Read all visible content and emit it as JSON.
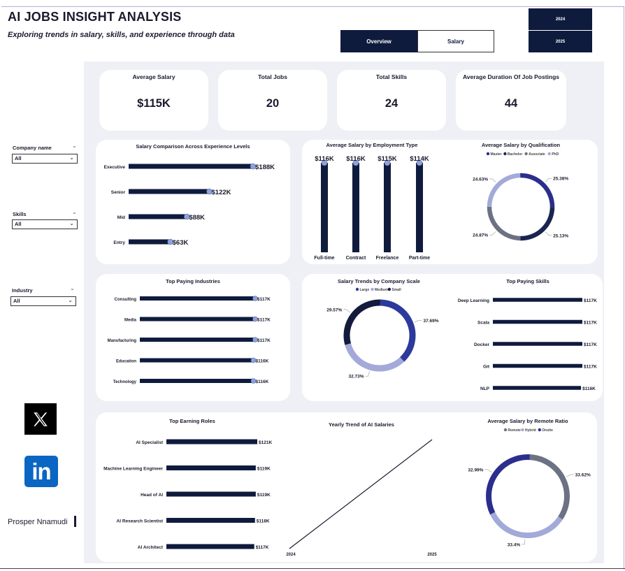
{
  "header": {
    "title": "AI JOBS INSIGHT ANALYSIS",
    "subtitle": "Exploring trends in salary, skills, and experience through data"
  },
  "tabs": {
    "overview": "Overview",
    "salary": "Salary"
  },
  "years": [
    "2024",
    "2025"
  ],
  "kpis": [
    {
      "label": "Average Salary",
      "value": "$115K"
    },
    {
      "label": "Total Jobs",
      "value": "20"
    },
    {
      "label": "Total Skills",
      "value": "24"
    },
    {
      "label": "Average Duration Of Job Postings",
      "value": "44"
    }
  ],
  "slicers": [
    {
      "label": "Company name",
      "value": "All"
    },
    {
      "label": "Skills",
      "value": "All"
    },
    {
      "label": "Industry",
      "value": "All"
    }
  ],
  "author": "Prosper Nnamudi",
  "colors": {
    "navy": "#0f1b3d",
    "dot": "#8ea2dc",
    "donut_dark_blue": "#2b2e8c",
    "donut_navy": "#1a2550",
    "donut_gray": "#6c7283",
    "donut_light": "#a3aad9",
    "background": "#eef0f5"
  },
  "icons": {
    "x_logo": "x-logo-icon",
    "linkedin": "linkedin-logo-icon"
  },
  "chart_data": [
    {
      "id": "experience",
      "type": "bar",
      "title": "Salary Comparison Across Experience Levels",
      "categories": [
        "Executive",
        "Senior",
        "Mid",
        "Entry"
      ],
      "values": [
        188,
        122,
        88,
        63
      ],
      "labels": [
        "$188K",
        "$122K",
        "$88K",
        "$63K"
      ],
      "max": 188
    },
    {
      "id": "employment",
      "type": "bar",
      "title": "Average Salary by Employment Type",
      "categories": [
        "Full-time",
        "Contract",
        "Freelance",
        "Part-time"
      ],
      "values": [
        116,
        116,
        115,
        114
      ],
      "labels": [
        "$116K",
        "$116K",
        "$115K",
        "$114K"
      ]
    },
    {
      "id": "qualification",
      "type": "pie",
      "title": "Average Salary by Qualification",
      "legend": [
        "Master",
        "Bachelor",
        "Associate",
        "PhD"
      ],
      "slices": [
        {
          "name": "Master",
          "value": 25.38,
          "label": "25.38%",
          "color": "#2b2e8c"
        },
        {
          "name": "Bachelor",
          "value": 25.13,
          "label": "25.13%",
          "color": "#1a2550"
        },
        {
          "name": "Associate",
          "value": 24.87,
          "label": "24.87%",
          "color": "#6c7283"
        },
        {
          "name": "PhD",
          "value": 24.63,
          "label": "24.63%",
          "color": "#a3aad9"
        }
      ]
    },
    {
      "id": "industries",
      "type": "bar",
      "title": "Top Paying Industries",
      "categories": [
        "Consulting",
        "Media",
        "Manufacturing",
        "Education",
        "Technology"
      ],
      "values": [
        117,
        117,
        117,
        116,
        116
      ],
      "labels": [
        "$117K",
        "$117K",
        "$117K",
        "$116K",
        "$116K"
      ]
    },
    {
      "id": "company_scale",
      "type": "pie",
      "title": "Salary Trends by Company Scale",
      "legend": [
        "Large",
        "Medium",
        "Small"
      ],
      "slices": [
        {
          "name": "Large",
          "value": 37.69,
          "label": "37.69%",
          "color": "#2b3a9b"
        },
        {
          "name": "Medium",
          "value": 32.73,
          "label": "32.73%",
          "color": "#a3aad9"
        },
        {
          "name": "Small",
          "value": 29.57,
          "label": "29.57%",
          "color": "#141a3c"
        }
      ]
    },
    {
      "id": "skills",
      "type": "bar",
      "title": "Top Paying Skills",
      "categories": [
        "Deep Learning",
        "Scala",
        "Docker",
        "Git",
        "NLP"
      ],
      "values": [
        117,
        117,
        117,
        117,
        116
      ],
      "labels": [
        "$117K",
        "$117K",
        "$117K",
        "$117K",
        "$116K"
      ]
    },
    {
      "id": "roles",
      "type": "bar",
      "title": "Top Earning Roles",
      "categories": [
        "AI Specialist",
        "Machine Learning Engineer",
        "Head of AI",
        "AI Research Scientist",
        "AI Architect"
      ],
      "values": [
        121,
        119,
        119,
        118,
        117
      ],
      "labels": [
        "$121K",
        "$119K",
        "$119K",
        "$118K",
        "$117K"
      ]
    },
    {
      "id": "yearly",
      "type": "line",
      "title": "Yearly Trend of AI Salaries",
      "x": [
        "2024",
        "2025"
      ],
      "trend": "increasing"
    },
    {
      "id": "remote",
      "type": "pie",
      "title": "Average Salary by Remote Ratio",
      "legend": [
        "Remote",
        "Hybrid",
        "Onsite"
      ],
      "slices": [
        {
          "name": "Remote",
          "value": 33.62,
          "label": "33.62%",
          "color": "#6c7283"
        },
        {
          "name": "Hybrid",
          "value": 33.4,
          "label": "33.4%",
          "color": "#a3aad9"
        },
        {
          "name": "Onsite",
          "value": 32.99,
          "label": "32.99%",
          "color": "#2b2e8c"
        }
      ]
    }
  ]
}
